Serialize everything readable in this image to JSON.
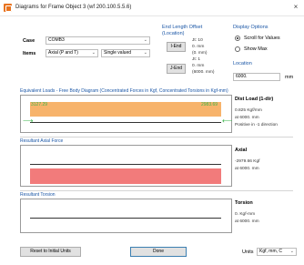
{
  "window": {
    "title": "Diagrams for Frame Object 3  (wf 200.100.5.5.6)",
    "close_glyph": "×"
  },
  "case": {
    "label": "Case",
    "value": "COMB3"
  },
  "items": {
    "label": "Items",
    "value": "Axial (P and T)",
    "secondary_value": "Single valued"
  },
  "end_length": {
    "heading": "End Length Offset",
    "subheading": "(Location)",
    "i_end_button": "I-End",
    "j_end_button": "J-End",
    "i_lines": [
      "Jt:  10",
      "0.  mm",
      "(0.  mm)"
    ],
    "j_lines": [
      "Jt:  1",
      "0.  mm",
      "(6000.  mm)"
    ]
  },
  "display_options": {
    "heading": "Display Options",
    "scroll_label": "Scroll for Values",
    "show_max_label": "Show Max",
    "scroll_selected": true,
    "location_heading": "Location",
    "location_value": "6000.",
    "location_unit": "mm"
  },
  "loads_section": {
    "title": "Equivalent Loads - Free Body Diagram  (Concentrated Forces in Kgf, Concentrated Torsions in Kgf-mm)",
    "left_value": "3127.29",
    "right_value": "2983.69",
    "info_title": "Dist Load (1-dir)",
    "info_lines": [
      "0.825 Kgf/mm",
      "at 6000. mm",
      "Positive in -1 direction"
    ]
  },
  "axial_section": {
    "title": "Resultant Axial Force",
    "info_title": "Axial",
    "info_lines": [
      "-2979.66 Kgf",
      "at 6000. mm"
    ]
  },
  "torsion_section": {
    "title": "Resultant Torsion",
    "info_title": "Torsion",
    "info_lines": [
      "0.  Kgf-mm",
      "at 6000. mm"
    ]
  },
  "footer": {
    "reset_button": "Reset to Initial Units",
    "done_button": "Done",
    "units_label": "Units",
    "units_value": "Kgf, mm, C"
  },
  "colors": {
    "accent_blue": "#1a56a6",
    "load_orange": "#f7b36b",
    "axial_red": "#f27b7b",
    "arrow_green": "#39b54a"
  }
}
